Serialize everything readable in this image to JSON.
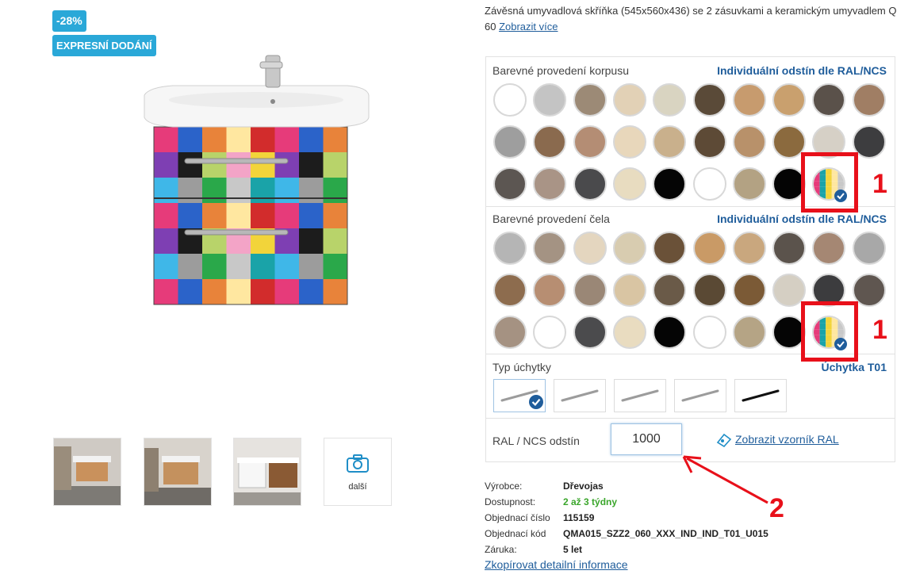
{
  "badges": {
    "discount": "-28%",
    "express": "EXPRESNÍ DODÁNÍ"
  },
  "description": {
    "text": "Závěsná umyvadlová skříňka (545x560x436) se 2 zásuvkami a keramickým umyvadlem Q 60 ",
    "more_link": "Zobrazit více"
  },
  "gallery": {
    "more_label": "další"
  },
  "corpus": {
    "label": "Barevné provedení korpusu",
    "custom_link": "Individuální odstín dle RAL/NCS",
    "swatches": [
      [
        "#ffffff",
        "#c4c4c4",
        "#9c8a76",
        "#e2d1b6",
        "#d9d4c1",
        "#5a4a38",
        "#c79b6e",
        "#c9a06e",
        "#5a514a",
        "#a07e64"
      ],
      [
        "#9e9e9e",
        "#8a6a4e",
        "#b48d74",
        "#e8d7bb",
        "#c9b08c",
        "#5d4a36",
        "#b8916a",
        "#8b6a3e",
        "#d6d0c6",
        "#3d3d3f"
      ],
      [
        "#5c5652",
        "#a99486",
        "#4a4a4c",
        "#e8dcc0",
        "#050505",
        "#ffffff",
        "#b3a283",
        "#040404",
        "mosaic"
      ]
    ]
  },
  "front": {
    "label": "Barevné provedení čela",
    "custom_link": "Individuální odstín dle RAL/NCS",
    "swatches": [
      [
        "#b5b5b5",
        "#a49383",
        "#e4d6bf",
        "#d8ccb0",
        "#6a5138",
        "#c99a66",
        "#c9a77e",
        "#5b534c",
        "#a58773",
        "#a8a8a8"
      ],
      [
        "#8d6c4e",
        "#b78e72",
        "#9a8776",
        "#d9c5a3",
        "#6a5a48",
        "#5a4934",
        "#7b5a36",
        "#d5cfc3",
        "#3c3c3e",
        "#5f5650"
      ],
      [
        "#a59282",
        "#ffffff",
        "#4b4b4d",
        "#e9dcc0",
        "#050505",
        "#ffffff",
        "#b5a485",
        "#050505",
        "mosaic"
      ]
    ]
  },
  "handle": {
    "label": "Typ úchytky",
    "selected": "Úchytka T01",
    "options": [
      {
        "name": "T01",
        "color": "#9c9c9c"
      },
      {
        "name": "T02",
        "color": "#9c9c9c"
      },
      {
        "name": "T03",
        "color": "#9c9c9c"
      },
      {
        "name": "T04",
        "color": "#9c9c9c"
      },
      {
        "name": "T05",
        "color": "#111111"
      }
    ]
  },
  "ral": {
    "label": "RAL / NCS odstín",
    "value": "1000",
    "sample_link": "Zobrazit vzorník RAL"
  },
  "details": [
    {
      "key": "Výrobce:",
      "value": "Dřevojas"
    },
    {
      "key": "Dostupnost:",
      "value": "2 až 3 týdny",
      "accent": "#3aa62b"
    },
    {
      "key": "Objednací číslo",
      "value": "115159"
    },
    {
      "key": "Objednací kód",
      "value": "QMA015_SZZ2_060_XXX_IND_IND_T01_U015"
    },
    {
      "key": "Záruka:",
      "value": "5 let"
    }
  ],
  "copy_link": "Zkopírovat detailní informace",
  "annotations": {
    "marker_1": "1",
    "marker_2": "2"
  },
  "colors": {
    "accent": "#1f5d9b",
    "badge": "#2aa8d8",
    "annotation": "#e8101a",
    "available": "#3aa62b"
  }
}
